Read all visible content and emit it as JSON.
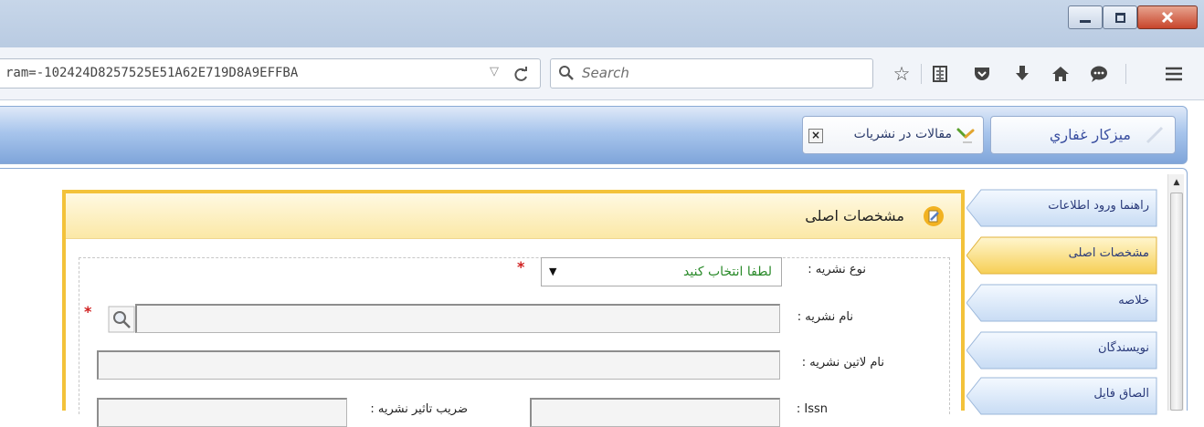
{
  "browser": {
    "url": "ram=-102424D8257525E51A62E719D8A9EFFBA",
    "search_placeholder": "Search",
    "window_buttons": [
      "minimize-icon",
      "maximize-icon",
      "close-icon"
    ],
    "toolbar_icons": [
      "star-icon",
      "reader-list-icon",
      "pocket-icon",
      "download-icon",
      "home-icon",
      "chat-icon",
      "menu-icon"
    ]
  },
  "app_tabs": {
    "home": "میزکار غفاري",
    "articles": "مقالات در نشریات"
  },
  "side_nav": {
    "items": [
      {
        "label": "راهنما ورود اطلاعات",
        "active": false
      },
      {
        "label": "مشخصات اصلی",
        "active": true
      },
      {
        "label": "خلاصه",
        "active": false
      },
      {
        "label": "نویسندگان",
        "active": false
      },
      {
        "label": "الصاق فایل",
        "active": false
      }
    ]
  },
  "form": {
    "title": "مشخصات اصلی",
    "fields": {
      "journal_type_label": "نوع نشریه :",
      "journal_type_value": "لطفا انتخاب کنید",
      "journal_name_label": "نام نشریه :",
      "journal_latin_name_label": "نام لاتین نشریه :",
      "issn_label": ": Issn",
      "impact_factor_label": "ضریب تاثیر نشریه :"
    },
    "required_marker": "*"
  },
  "colors": {
    "accent_yellow": "#f3c23a",
    "tab_blue": "#7fa5da",
    "required_red": "#d01f1f",
    "select_green": "#2a8a2a"
  }
}
